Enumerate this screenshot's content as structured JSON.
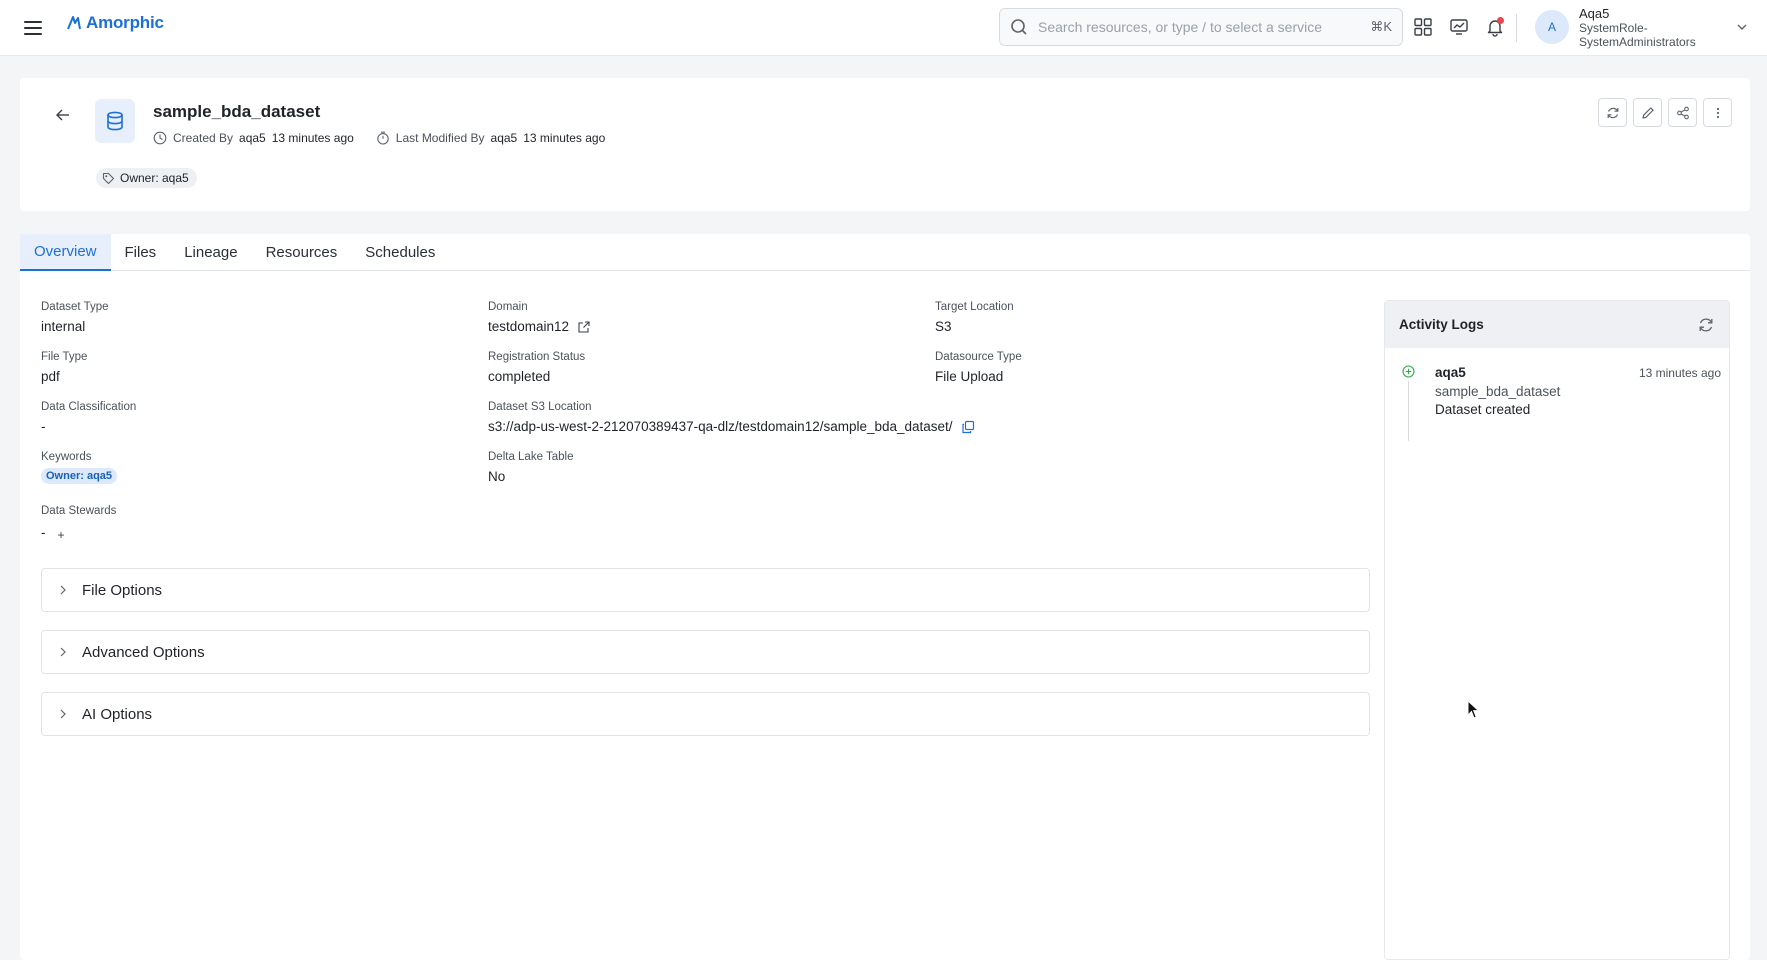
{
  "app": {
    "logo_text": "Amorphic"
  },
  "search": {
    "placeholder": "Search resources, or type / to select a service",
    "shortcut": "⌘K"
  },
  "user": {
    "initial": "A",
    "name": "Aqa5",
    "role": "SystemRole-SystemAdministrators"
  },
  "dataset": {
    "name": "sample_bda_dataset",
    "created_label": "Created By",
    "created_by": "aqa5",
    "created_ago": "13 minutes ago",
    "modified_label": "Last Modified By",
    "modified_by": "aqa5",
    "modified_ago": "13 minutes ago",
    "owner_tag": "Owner: aqa5"
  },
  "tabs": [
    "Overview",
    "Files",
    "Lineage",
    "Resources",
    "Schedules"
  ],
  "overview": {
    "dataset_type": {
      "label": "Dataset Type",
      "value": "internal"
    },
    "domain": {
      "label": "Domain",
      "value": "testdomain12"
    },
    "target_location": {
      "label": "Target Location",
      "value": "S3"
    },
    "file_type": {
      "label": "File Type",
      "value": "pdf"
    },
    "registration_status": {
      "label": "Registration Status",
      "value": "completed"
    },
    "datasource_type": {
      "label": "Datasource Type",
      "value": "File Upload"
    },
    "data_classification": {
      "label": "Data Classification",
      "value": "-"
    },
    "s3_location": {
      "label": "Dataset S3 Location",
      "value": "s3://adp-us-west-2-212070389437-qa-dlz/testdomain12/sample_bda_dataset/"
    },
    "keywords": {
      "label": "Keywords",
      "value": "Owner: aqa5"
    },
    "delta_lake": {
      "label": "Delta Lake Table",
      "value": "No"
    },
    "data_stewards": {
      "label": "Data Stewards",
      "value": "-",
      "add": "+"
    }
  },
  "accordions": [
    "File Options",
    "Advanced Options",
    "AI Options"
  ],
  "activity": {
    "title": "Activity Logs",
    "items": [
      {
        "user": "aqa5",
        "time": "13 minutes ago",
        "dataset": "sample_bda_dataset",
        "message": "Dataset created"
      }
    ]
  },
  "colors": {
    "accent": "#1d6fd8",
    "success": "#2fa84f",
    "notification": "#e5484d"
  }
}
